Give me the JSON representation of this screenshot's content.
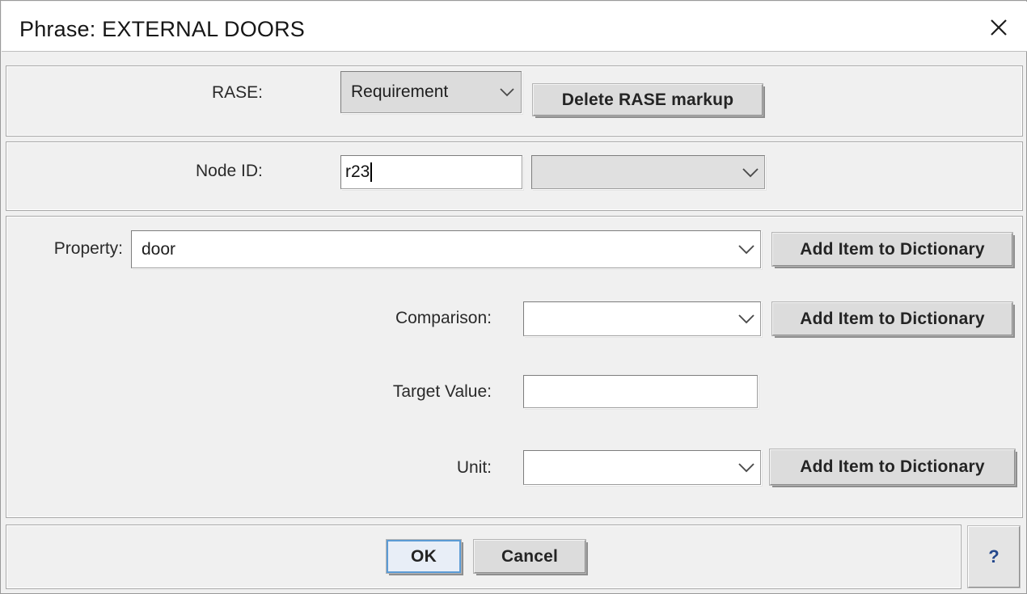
{
  "window": {
    "title": "Phrase: EXTERNAL DOORS",
    "close_icon": "close-icon"
  },
  "rase_row": {
    "label": "RASE:",
    "combo_value": "Requirement",
    "combo_arrow_icon": "chevron-down-icon",
    "delete_button": "Delete RASE markup"
  },
  "node_row": {
    "label": "Node ID:",
    "input_value": "r23",
    "combo_value": "",
    "combo_arrow_icon": "chevron-down-icon"
  },
  "property_row": {
    "label": "Property:",
    "combo_value": "door",
    "combo_arrow_icon": "chevron-down-icon",
    "add_button": "Add Item to Dictionary"
  },
  "comparison_row": {
    "label": "Comparison:",
    "combo_value": "",
    "combo_arrow_icon": "chevron-down-icon",
    "add_button": "Add Item to Dictionary"
  },
  "target_value_row": {
    "label": "Target Value:",
    "input_value": ""
  },
  "unit_row": {
    "label": "Unit:",
    "combo_value": "",
    "combo_arrow_icon": "chevron-down-icon",
    "add_button": "Add Item to Dictionary"
  },
  "footer": {
    "ok_label": "OK",
    "cancel_label": "Cancel",
    "help_label": "?"
  },
  "colors": {
    "window_bg": "#f0f0f0",
    "titlebar_bg": "#ffffff",
    "button_face": "#dcdcdc",
    "default_button_fill": "#e8eef7",
    "default_button_border": "#5b9bd5",
    "help_glyph": "#23478c",
    "field_bg": "#ffffff"
  }
}
